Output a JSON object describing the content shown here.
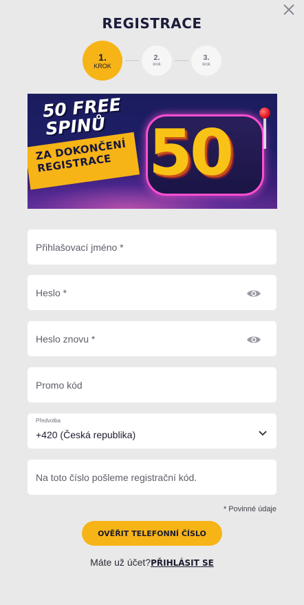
{
  "header": {
    "title": "REGISTRACE",
    "close_icon": "close-icon"
  },
  "steps": [
    {
      "num": "1.",
      "label": "KROK",
      "active": true
    },
    {
      "num": "2.",
      "label": "krok",
      "active": false
    },
    {
      "num": "3.",
      "label": "krok",
      "active": false
    }
  ],
  "banner": {
    "line1": "50 FREE",
    "line2": "SPINŮ",
    "ribbon_line1": "ZA DOKONČENÍ",
    "ribbon_line2": "REGISTRACE",
    "big_number": "50"
  },
  "form": {
    "username_placeholder": "Přihlašovací jméno *",
    "password_placeholder": "Heslo *",
    "password_repeat_placeholder": "Heslo znovu *",
    "promo_placeholder": "Promo kód",
    "prefix_label": "Předvolba",
    "prefix_value": "+420 (Česká republika)",
    "phone_placeholder": "Na toto číslo pošleme registrační kód.",
    "required_note": "* Povinné údaje"
  },
  "actions": {
    "verify_label": "OVĚŘIT TELEFONNÍ ČÍSLO",
    "have_account": "Máte už účet?",
    "login_link": "PŘIHLÁSIT SE"
  },
  "colors": {
    "accent": "#f7b417",
    "background": "#e9e9ea",
    "title": "#1c1c3a"
  }
}
